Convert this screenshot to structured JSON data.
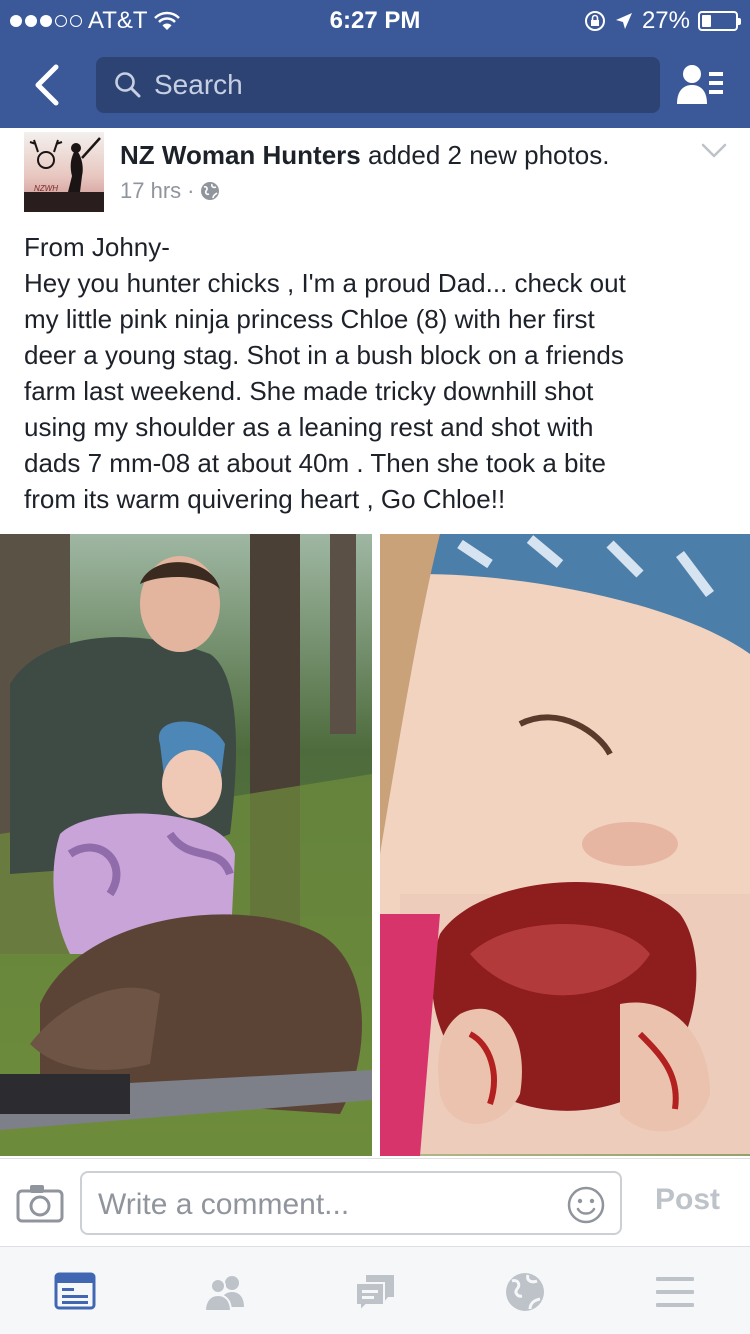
{
  "status_bar": {
    "carrier": "AT&T",
    "time": "6:27 PM",
    "battery": "27%",
    "battery_level": 0.27,
    "signal_bars_filled": 3,
    "signal_bars_total": 5
  },
  "nav": {
    "search_placeholder": "Search",
    "back_icon": "chevron-left-icon",
    "friends_icon": "friend-requests-icon"
  },
  "post": {
    "poster_name": "NZ Woman Hunters",
    "action": "added 2 new photos.",
    "time_ago": "17 hrs",
    "separator": "·",
    "privacy_icon": "globe-icon",
    "avatar_text": "NZWH",
    "text_lines": [
      "From Johny-",
      "Hey you hunter chicks , I'm a proud Dad... check out",
      "my little pink ninja princess Chloe (8) with her first",
      "deer a young stag. Shot in a bush block on a friends",
      "farm last weekend. She made  tricky downhill shot",
      "using my shoulder as a leaning rest and shot with",
      "dads 7 mm-08 at about 40m . Then she took a bite",
      "from its warm quivering heart , Go Chloe!!"
    ]
  },
  "comment_bar": {
    "placeholder": "Write a comment...",
    "post_label": "Post"
  },
  "tabs": [
    {
      "icon": "news-feed-icon",
      "active": true
    },
    {
      "icon": "friends-icon",
      "active": false
    },
    {
      "icon": "messages-icon",
      "active": false
    },
    {
      "icon": "globe-notifications-icon",
      "active": false
    },
    {
      "icon": "menu-icon",
      "active": false
    }
  ],
  "colors": {
    "brand_blue": "#3b5998",
    "search_bg": "#2d4373",
    "active_tab": "#4267b2",
    "inactive_tab": "#bec3c9"
  }
}
